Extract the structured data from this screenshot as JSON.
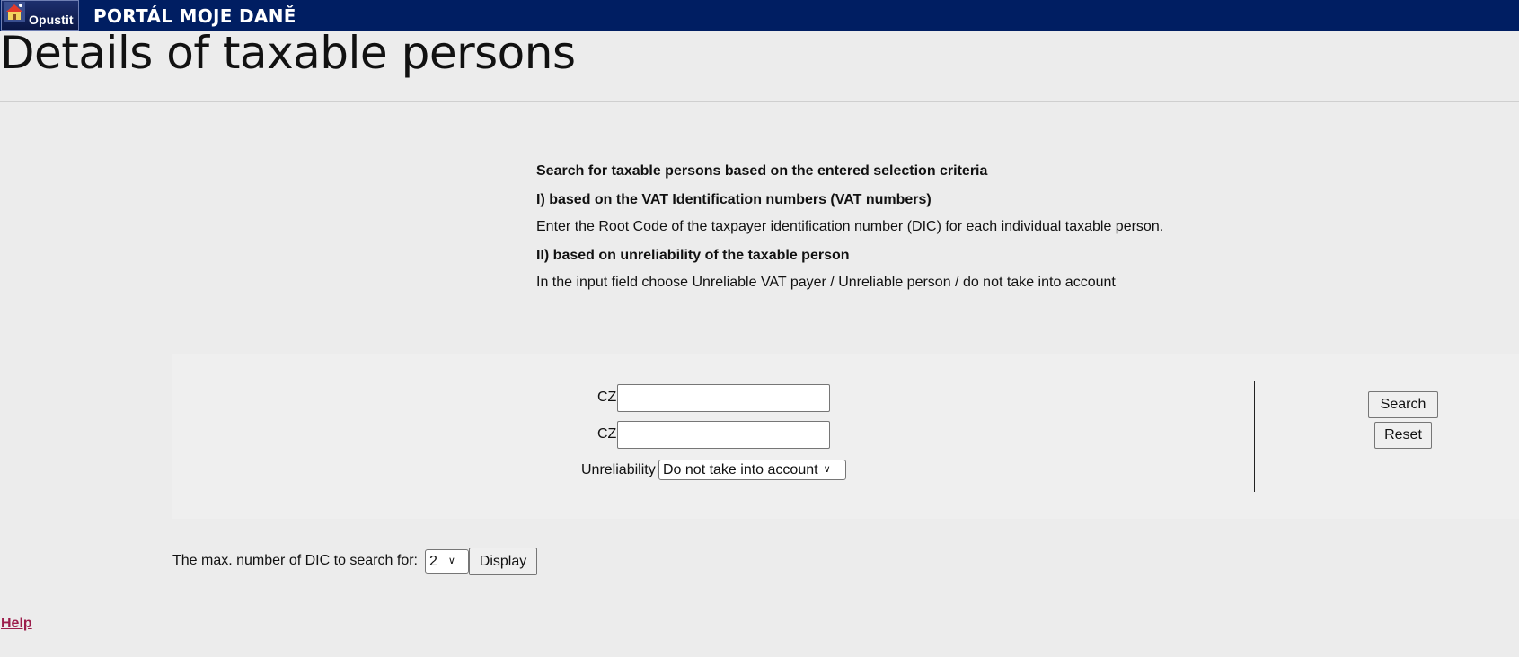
{
  "header": {
    "exit_button_label": "Opustit",
    "portal_title": "PORTÁL MOJE DANĚ",
    "bar_color": "#001e62"
  },
  "page": {
    "title": "Details of taxable persons"
  },
  "info": {
    "heading": "Search for taxable persons based on the entered selection criteria",
    "section1_title": "I) based on the VAT Identification numbers (VAT numbers)",
    "section1_text": "Enter the Root Code of the taxpayer identification number (DIC) for each individual taxable person.",
    "section2_title": "II) based on unreliability of the taxable person",
    "section2_text": "In the input field choose Unreliable VAT payer / Unreliable person / do not take into account"
  },
  "form": {
    "dic_prefix_1": "CZ",
    "dic_value_1": "",
    "dic_prefix_2": "CZ",
    "dic_value_2": "",
    "unreliability_label": "Unreliability",
    "unreliability_selected": "Do not take into account",
    "search_button": "Search",
    "reset_button": "Reset"
  },
  "max_dic": {
    "label": "The max. number of DIC to search for:",
    "selected": "2",
    "display_button": "Display"
  },
  "footer": {
    "help_link": "Help",
    "help_color": "#9c1d4b"
  }
}
